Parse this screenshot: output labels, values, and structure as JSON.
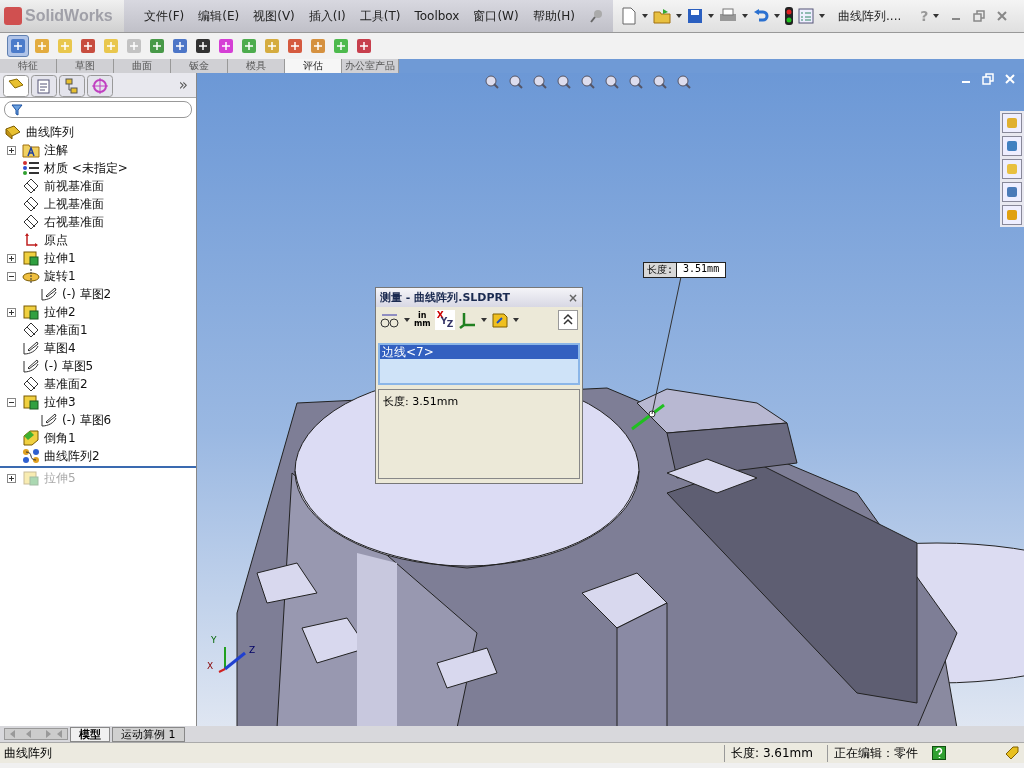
{
  "app": {
    "logo": "SolidWorks"
  },
  "menu": [
    "文件(F)",
    "编辑(E)",
    "视图(V)",
    "插入(I)",
    "工具(T)",
    "Toolbox",
    "窗口(W)",
    "帮助(H)"
  ],
  "document_title": "曲线阵列....",
  "help_label": "?",
  "command_tabs": [
    {
      "label": "特征",
      "selected": false
    },
    {
      "label": "草图",
      "selected": false
    },
    {
      "label": "曲面",
      "selected": false
    },
    {
      "label": "钣金",
      "selected": false
    },
    {
      "label": "模具",
      "selected": false
    },
    {
      "label": "评估",
      "selected": true
    },
    {
      "label": "办公室产品",
      "selected": false
    }
  ],
  "panel_tabs": [
    {
      "kind": "tree",
      "selected": true
    },
    {
      "kind": "property",
      "selected": false
    },
    {
      "kind": "config",
      "selected": false
    },
    {
      "kind": "display",
      "selected": false
    }
  ],
  "panel_expand": "»",
  "feature_tree": {
    "root": "曲线阵列",
    "items": [
      {
        "label": "注解",
        "kind": "annotation",
        "expanded": false,
        "disabled": false
      },
      {
        "label": "材质 <未指定>",
        "kind": "material",
        "disabled": false
      },
      {
        "label": "前视基准面",
        "kind": "plane",
        "disabled": false
      },
      {
        "label": "上视基准面",
        "kind": "plane",
        "disabled": false
      },
      {
        "label": "右视基准面",
        "kind": "plane",
        "disabled": false
      },
      {
        "label": "原点",
        "kind": "origin",
        "disabled": false
      },
      {
        "label": "拉伸1",
        "kind": "extrude",
        "expanded": false,
        "disabled": false
      },
      {
        "label": "旋转1",
        "kind": "revolve",
        "expanded": true,
        "disabled": false,
        "children": [
          {
            "label": "(-) 草图2",
            "kind": "sketch",
            "disabled": false
          }
        ]
      },
      {
        "label": "拉伸2",
        "kind": "extrude",
        "expanded": false,
        "disabled": false
      },
      {
        "label": "基准面1",
        "kind": "plane",
        "disabled": false
      },
      {
        "label": "草图4",
        "kind": "sketch",
        "disabled": false
      },
      {
        "label": "(-) 草图5",
        "kind": "sketch",
        "disabled": false
      },
      {
        "label": "基准面2",
        "kind": "plane",
        "disabled": false
      },
      {
        "label": "拉伸3",
        "kind": "extrude",
        "expanded": true,
        "disabled": false,
        "children": [
          {
            "label": "(-) 草图6",
            "kind": "sketch",
            "disabled": false
          }
        ]
      },
      {
        "label": "倒角1",
        "kind": "chamfer",
        "disabled": false
      },
      {
        "label": "曲线阵列2",
        "kind": "pattern",
        "disabled": false
      },
      {
        "kind": "rollback-bar"
      },
      {
        "label": "拉伸5",
        "kind": "extrude",
        "expanded": false,
        "disabled": true
      }
    ]
  },
  "callout": {
    "label": "长度:",
    "value": "3.51mm"
  },
  "measure_dialog": {
    "title": "测量 - 曲线阵列.SLDPRT",
    "close": "×",
    "units": {
      "top": "in",
      "bottom": "mm"
    },
    "axes": [
      "X",
      "Y",
      "Z"
    ],
    "selections": [
      {
        "label": "边线<7>",
        "selected": true
      }
    ],
    "result": "长度: 3.51mm"
  },
  "triad": [
    "Y",
    "Z",
    "X"
  ],
  "bottom_tabs": [
    {
      "label": "模型",
      "selected": true
    },
    {
      "label": "运动算例 1",
      "selected": false
    }
  ],
  "status_bar": {
    "message": "曲线阵列",
    "length": "长度: 3.61mm",
    "mode": "正在编辑：零件"
  }
}
